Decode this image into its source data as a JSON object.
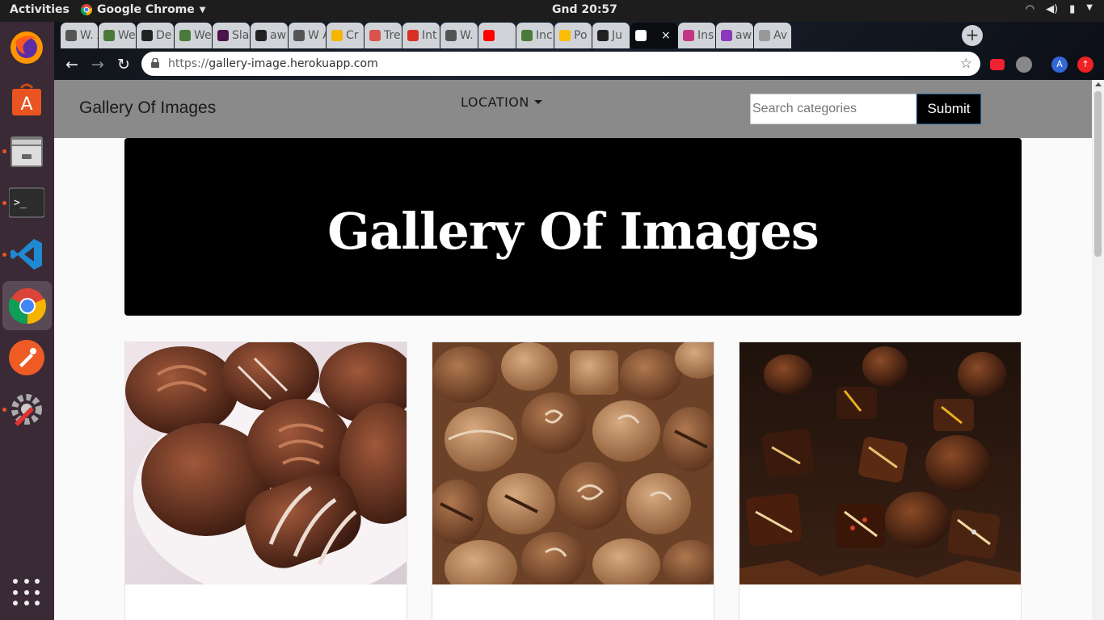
{
  "system": {
    "activities": "Activities",
    "app_name": "Google Chrome",
    "clock": "Gnd 20:57"
  },
  "browser": {
    "tabs": [
      {
        "label": "W. Aw",
        "icon": "wikipedia-icon",
        "color": "#555555"
      },
      {
        "label": "We",
        "icon": "tree-icon",
        "color": "#4a7a3a"
      },
      {
        "label": "De",
        "icon": "github-icon",
        "color": "#222222"
      },
      {
        "label": "We",
        "icon": "tree-icon",
        "color": "#4a7a3a"
      },
      {
        "label": "Sla",
        "icon": "slack-icon",
        "color": "#4a154b"
      },
      {
        "label": "aw",
        "icon": "github-icon",
        "color": "#222222"
      },
      {
        "label": "W Av",
        "icon": "wikipedia-icon",
        "color": "#555555"
      },
      {
        "label": "Cr",
        "icon": "slides-icon",
        "color": "#f4b400"
      },
      {
        "label": "Tre",
        "icon": "trello-icon",
        "color": "#d9534f"
      },
      {
        "label": "Int",
        "icon": "gmail-icon",
        "color": "#d93025"
      },
      {
        "label": "W. Ch",
        "icon": "wikipedia-icon",
        "color": "#555555"
      },
      {
        "label": "",
        "icon": "youtube-icon",
        "color": "#ff0000"
      },
      {
        "label": "Inc",
        "icon": "tree-icon",
        "color": "#4a7a3a"
      },
      {
        "label": "Po",
        "icon": "photos-icon",
        "color": "#fbbc04"
      },
      {
        "label": "Ju",
        "icon": "github-icon",
        "color": "#222222"
      },
      {
        "label": "",
        "icon": "globe-icon",
        "color": "#ffffff",
        "active": true
      },
      {
        "label": "Ins",
        "icon": "instagram-icon",
        "color": "#c13584"
      },
      {
        "label": "aw",
        "icon": "hackerrank-icon",
        "color": "#8a3ab9"
      },
      {
        "label": "Av",
        "icon": "globe-icon",
        "color": "#999999"
      }
    ],
    "url": "https://gallery-image.herokuapp.com",
    "url_scheme": "https://",
    "url_host": "gallery-image.herokuapp.com",
    "profile_initial": "A"
  },
  "site": {
    "brand": "Gallery Of Images",
    "location_menu": "LOCATION",
    "search_placeholder": "Search categories",
    "submit_label": "Submit",
    "hero_title": "Gallery Of Images",
    "cards": [
      {
        "image": "chocolates-plate"
      },
      {
        "image": "chocolates-assorted"
      },
      {
        "image": "chocolates-dark"
      }
    ]
  }
}
